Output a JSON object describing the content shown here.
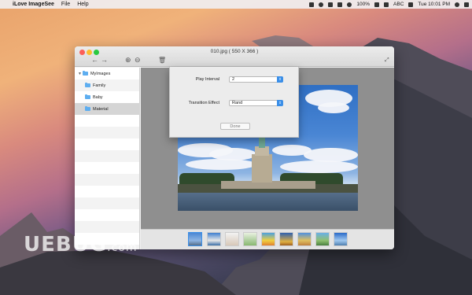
{
  "menubar": {
    "app_name": "iLove ImageSee",
    "items": [
      "File",
      "Help"
    ],
    "battery": "100%",
    "input_source": "ABC",
    "clock": "Tue 10:01 PM"
  },
  "window": {
    "title": "010.jpg ( 550 X 366 )"
  },
  "sidebar": {
    "root": "MyImages",
    "items": [
      "Family",
      "Baby",
      "Material"
    ],
    "selected": "Material"
  },
  "settings": {
    "play_interval_label": "Play Interval",
    "play_interval_value": "2",
    "transition_label": "Transition Effect",
    "transition_value": "Rand",
    "done_label": "Done"
  },
  "thumbnails": {
    "count": 9,
    "selected_index": 0
  },
  "watermark": {
    "text": "UEBUG",
    "suffix": ".com"
  },
  "colors": {
    "accent": "#3b8fe8",
    "folder": "#5eaef0"
  }
}
